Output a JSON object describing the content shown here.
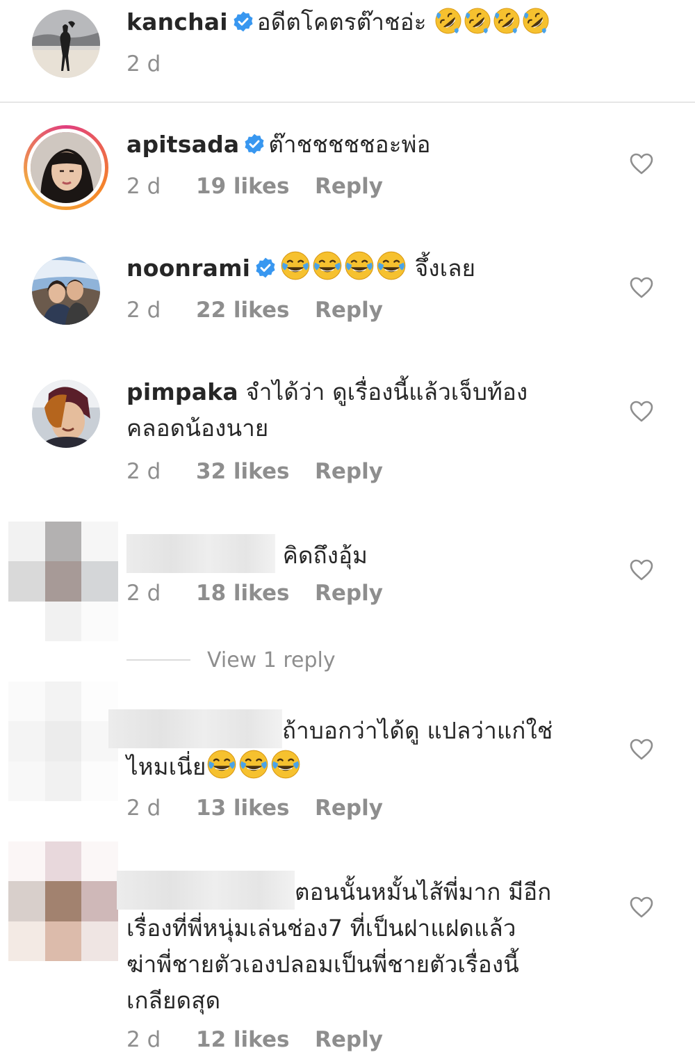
{
  "caption": {
    "username": "kanchai",
    "text": "อดีตโคตรต๊าชอ่ะ",
    "emoji": "rolling-on-floor-laughing",
    "emoji_count": 4,
    "time": "2 d"
  },
  "comments": [
    {
      "username": "apitsada",
      "verified": true,
      "text": "ต๊าชชชชชอะพ่อ",
      "time": "2 d",
      "likes": "19 likes",
      "reply": "Reply"
    },
    {
      "username": "noonrami",
      "verified": true,
      "text": "จึ้งเลย",
      "emoji": "face-with-tears-of-joy",
      "emoji_count": 4,
      "time": "2 d",
      "likes": "22 likes",
      "reply": "Reply"
    },
    {
      "username": "pimpaka",
      "verified": false,
      "text_line1": "จำได้ว่า ดูเรื่องนี้แล้วเจ็บท้อง",
      "text_line2": "คลอดน้องนาย",
      "time": "2 d",
      "likes": "32 likes",
      "reply": "Reply"
    },
    {
      "username": "",
      "text": "คิดถึงอุ้ม",
      "time": "2 d",
      "likes": "18 likes",
      "reply": "Reply",
      "view_replies": "View 1 reply"
    },
    {
      "username": "",
      "text_line1": "ถ้าบอกว่าได้ดู แปลว่าแก่ใช่",
      "text_line2": "ไหมเนี่ย",
      "emoji": "face-with-tears-of-joy",
      "emoji_count": 3,
      "time": "2 d",
      "likes": "13 likes",
      "reply": "Reply"
    },
    {
      "username": "",
      "text_line1": "ตอนนั้นหมั้นไส้พี่มาก มีอีก",
      "text_line2": "เรื่องที่พี่หนุ่มเล่นช่อง7 ที่เป็นฝาแฝดแล้ว",
      "text_line3": "ฆ่าพี่ชายตัวเองปลอมเป็นพี่ชายตัวเรื่องนี้",
      "text_line4": "เกลียดสุด",
      "time": "2 d",
      "likes": "12 likes",
      "reply": "Reply"
    }
  ],
  "colors": {
    "text": "#262626",
    "meta": "#8e8e8e",
    "verified": "#3897f0",
    "divider": "#e6e6e6"
  }
}
